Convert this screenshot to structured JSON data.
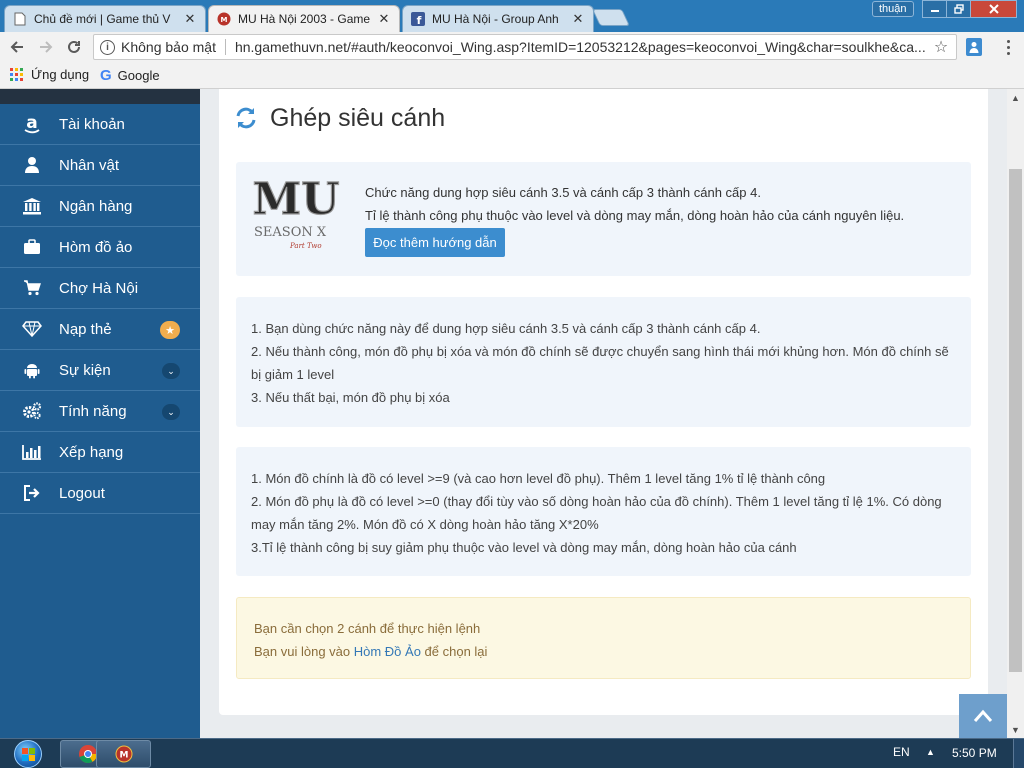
{
  "browser": {
    "tabs": [
      {
        "title": "Chủ đề mới | Game thủ V",
        "icon": "page-icon"
      },
      {
        "title": "MU Hà Nội 2003 - Game",
        "icon": "mu-favicon"
      },
      {
        "title": "MU Hà Nội - Group Anh",
        "icon": "facebook-icon"
      }
    ],
    "user_chip": "thuận",
    "security_label": "Không bảo mật",
    "url": "hn.gamethuvn.net/#auth/keoconvoi_Wing.asp?ItemID=12053212&pages=keoconvoi_Wing&char=soulkhe&ca...",
    "bookmarks": {
      "apps_label": "Ứng dụng",
      "google_label": "Google"
    }
  },
  "sidebar": {
    "items": [
      {
        "label": "Tài khoản",
        "icon": "amazon-icon"
      },
      {
        "label": "Nhân vật",
        "icon": "user-icon"
      },
      {
        "label": "Ngân hàng",
        "icon": "bank-icon"
      },
      {
        "label": "Hòm đồ ảo",
        "icon": "briefcase-icon"
      },
      {
        "label": "Chợ Hà Nội",
        "icon": "cart-icon"
      },
      {
        "label": "Nạp thẻ",
        "icon": "diamond-icon",
        "badge": "star-icon"
      },
      {
        "label": "Sự kiện",
        "icon": "android-icon",
        "chevron": "chevron-down-icon"
      },
      {
        "label": "Tính năng",
        "icon": "cogs-icon",
        "chevron": "chevron-down-icon"
      },
      {
        "label": "Xếp hạng",
        "icon": "bar-chart-icon"
      },
      {
        "label": "Logout",
        "icon": "sign-out-icon"
      }
    ]
  },
  "main": {
    "title": "Ghép siêu cánh",
    "intro": {
      "logo_text": "MU",
      "logo_sub": "SEASON X",
      "logo_tagline": "Part Two",
      "line1": "Chức năng dung hợp siêu cánh 3.5 và cánh cấp 3 thành cánh cấp 4.",
      "line2": "Tỉ lệ thành công phụ thuộc vào level và dòng may mắn, dòng hoàn hảo của cánh nguyên liệu.",
      "button": "Đọc thêm hướng dẫn"
    },
    "rules1": [
      "1. Bạn dùng chức năng này để dung hợp siêu cánh 3.5 và cánh cấp 3 thành cánh cấp 4.",
      "2. Nếu thành công, món đồ phụ bị xóa và món đồ chính sẽ được chuyển sang hình thái mới khủng hơn. Món đồ chính sẽ bị giảm 1 level",
      "3. Nếu thất bại, món đồ phụ bị xóa"
    ],
    "rules2": [
      "1. Món đồ chính là đồ có level >=9 (và cao hơn level đồ phụ). Thêm 1 level tăng 1% tỉ lệ thành công",
      "2. Món đồ phụ là đồ có level >=0 (thay đổi tùy vào số dòng hoàn hảo của đồ chính). Thêm 1 level tăng tỉ lệ 1%. Có dòng may mắn tăng 2%. Món đồ có X dòng hoàn hảo tăng X*20%",
      "3.Tỉ lệ thành công bị suy giảm phụ thuộc vào level và dòng may mắn, dòng hoàn hảo của cánh"
    ],
    "alert": {
      "line1": "Bạn cần chọn 2 cánh để thực hiện lệnh",
      "line2_prefix": "Bạn vui lòng vào ",
      "line2_link": "Hòm Đồ Ảo",
      "line2_suffix": " để chọn lại"
    }
  },
  "taskbar": {
    "lang": "EN",
    "time": "5:50 PM"
  },
  "colors": {
    "sidebar": "#1f5c8f",
    "accent_button": "#3c8dcf",
    "info_box": "#f0f5fb",
    "alert_bg": "#fcf8e3",
    "alert_text": "#8a6d3b"
  }
}
